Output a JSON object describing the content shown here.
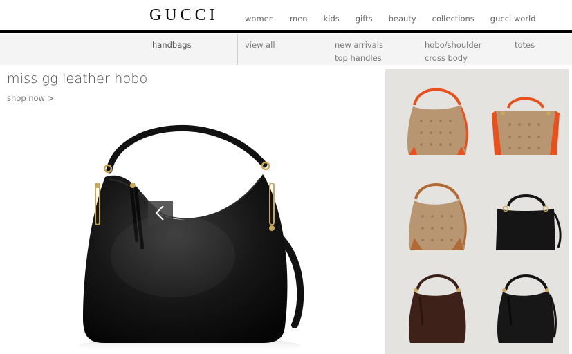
{
  "header": {
    "logo": "GUCCI",
    "nav": [
      "women",
      "men",
      "kids",
      "gifts",
      "beauty",
      "collections",
      "gucci world"
    ]
  },
  "subnav": {
    "category": "handbags",
    "links": {
      "view_all": "view all",
      "new_arrivals": "new arrivals",
      "top_handles": "top handles",
      "hobo_shoulder": "hobo/shoulder",
      "cross_body": "cross body",
      "totes": "totes"
    }
  },
  "hero": {
    "title": "miss gg leather hobo",
    "cta": "shop now >"
  },
  "colors": {
    "black_bar": "#000000",
    "subnav_bg": "#f4f4f4",
    "grid_bg": "#e4e3e0",
    "orange_trim": "#e8501e",
    "brown_trim": "#b06a35",
    "canvas_tan": "#b99672"
  },
  "products": [
    {
      "name": "gg-canvas-orange-hobo-icon"
    },
    {
      "name": "gg-canvas-orange-top-handle-icon"
    },
    {
      "name": "gg-canvas-brown-hobo-icon"
    },
    {
      "name": "black-leather-top-handle-icon"
    },
    {
      "name": "brown-guccissima-hobo-icon"
    },
    {
      "name": "black-guccissima-hobo-icon"
    }
  ]
}
